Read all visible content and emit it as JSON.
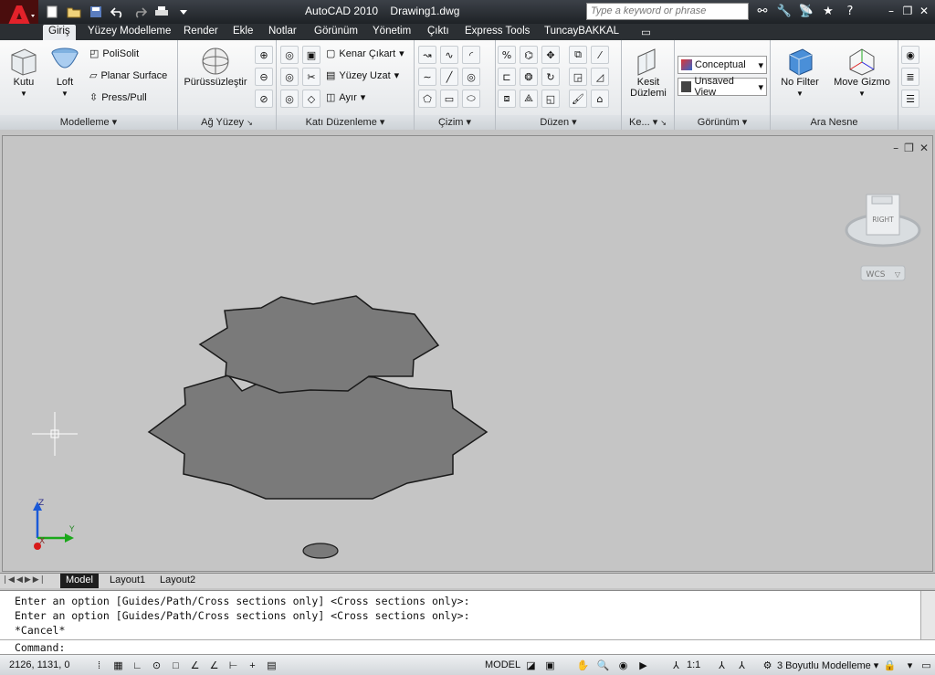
{
  "app": {
    "title": "AutoCAD 2010",
    "document": "Drawing1.dwg",
    "search_placeholder": "Type a keyword or phrase"
  },
  "tabs": [
    {
      "label": "Giriş",
      "active": true
    },
    {
      "label": "Yüzey Modelleme"
    },
    {
      "label": "Render"
    },
    {
      "label": "Ekle"
    },
    {
      "label": "Notlar"
    },
    {
      "label": "Görünüm"
    },
    {
      "label": "Yönetim"
    },
    {
      "label": "Çıktı"
    },
    {
      "label": "Express Tools"
    },
    {
      "label": "TuncayBAKKAL"
    }
  ],
  "ribbon": {
    "modelleme": {
      "title": "Modelleme",
      "kutu": "Kutu",
      "loft": "Loft",
      "polisolit": "PoliSolit",
      "planar": "Planar Surface",
      "presspull": "Press/Pull"
    },
    "ag_yuzey": {
      "title": "Ağ Yüzey",
      "puruzsuzlestir": "Pürüssüzleştir"
    },
    "kati": {
      "title": "Katı Düzenleme",
      "kenar": "Kenar Çıkart",
      "yuzey": "Yüzey Uzat",
      "ayir": "Ayır"
    },
    "cizim": {
      "title": "Çizim"
    },
    "duzen": {
      "title": "Düzen"
    },
    "kesit": {
      "title": "Ke...",
      "kesit_label_1": "Kesit",
      "kesit_label_2": "Düzlemi"
    },
    "gorunum": {
      "title": "Görünüm",
      "visual_style": "Conceptual",
      "view": "Unsaved View"
    },
    "ara_nesne": {
      "title": "Ara Nesne",
      "nofilter": "No Filter",
      "movegizmo": "Move Gizmo"
    }
  },
  "viewcube": {
    "face": "RIGHT",
    "wcs": "WCS"
  },
  "ucs": {
    "x": "X",
    "y": "Y",
    "z": "Z"
  },
  "layout_tabs": [
    {
      "label": "Model",
      "active": true
    },
    {
      "label": "Layout1"
    },
    {
      "label": "Layout2"
    }
  ],
  "command": {
    "history": [
      "Enter an option [Guides/Path/Cross sections only] <Cross sections only>:",
      "Enter an option [Guides/Path/Cross sections only] <Cross sections only>:",
      "*Cancel*"
    ],
    "prompt": "Command:"
  },
  "status": {
    "coords": "2126, 1131, 0",
    "model": "MODEL",
    "scale": "1:1",
    "workspace": "3 Boyutlu Modelleme"
  }
}
